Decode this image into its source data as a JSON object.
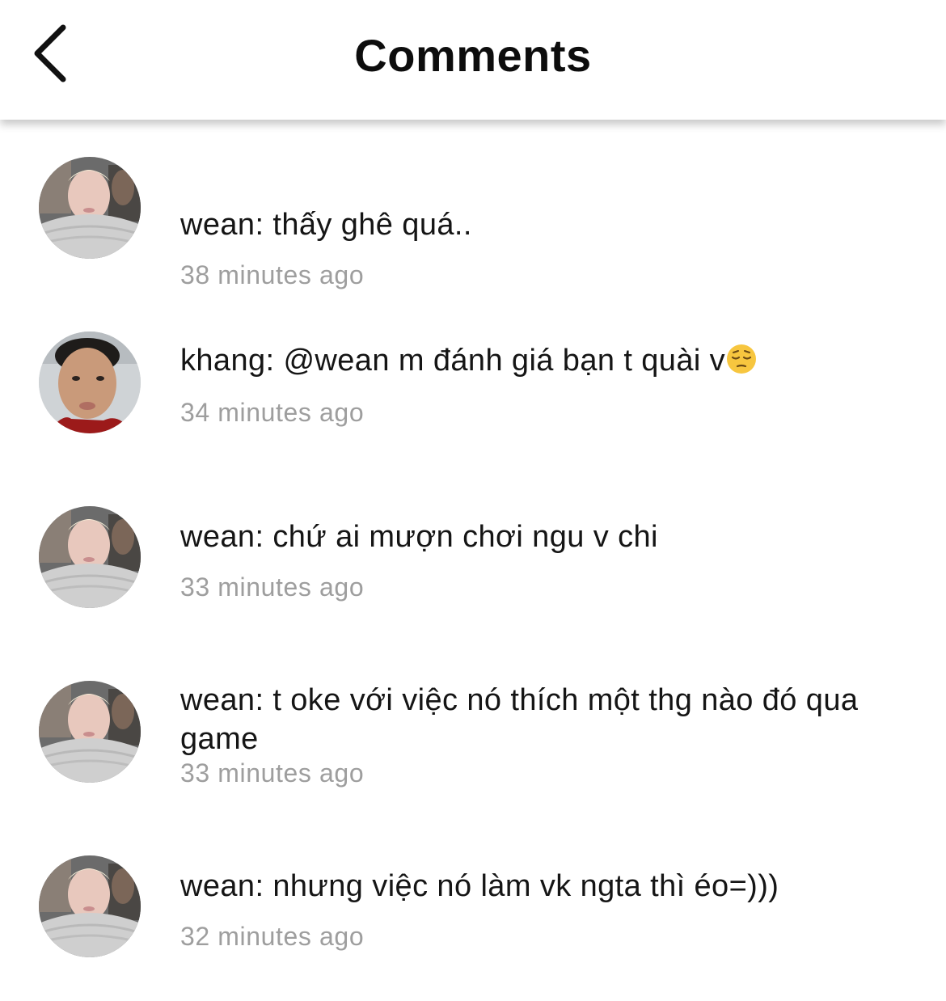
{
  "header": {
    "title": "Comments",
    "back_icon": "chevron-left-icon"
  },
  "comments": [
    {
      "text": "wean: thấy ghê quá..",
      "time": "38 minutes ago",
      "avatar": "avatar-wean"
    },
    {
      "text": "khang: @wean m đánh giá bạn t quài v",
      "emoji": "pensive-face-emoji",
      "time": "34 minutes ago",
      "avatar": "avatar-khang"
    },
    {
      "text": "wean: chứ ai mượn chơi ngu v chi",
      "time": "33 minutes ago",
      "avatar": "avatar-wean"
    },
    {
      "text": "wean: t oke với việc nó thích một thg nào đó qua game",
      "time": "33 minutes ago",
      "avatar": "avatar-wean"
    },
    {
      "text": "wean: nhưng việc nó làm vk ngta thì éo=)))",
      "time": "32 minutes ago",
      "avatar": "avatar-wean"
    }
  ],
  "colors": {
    "text": "#151515",
    "timestamp": "#9e9e9e",
    "background": "#ffffff"
  }
}
